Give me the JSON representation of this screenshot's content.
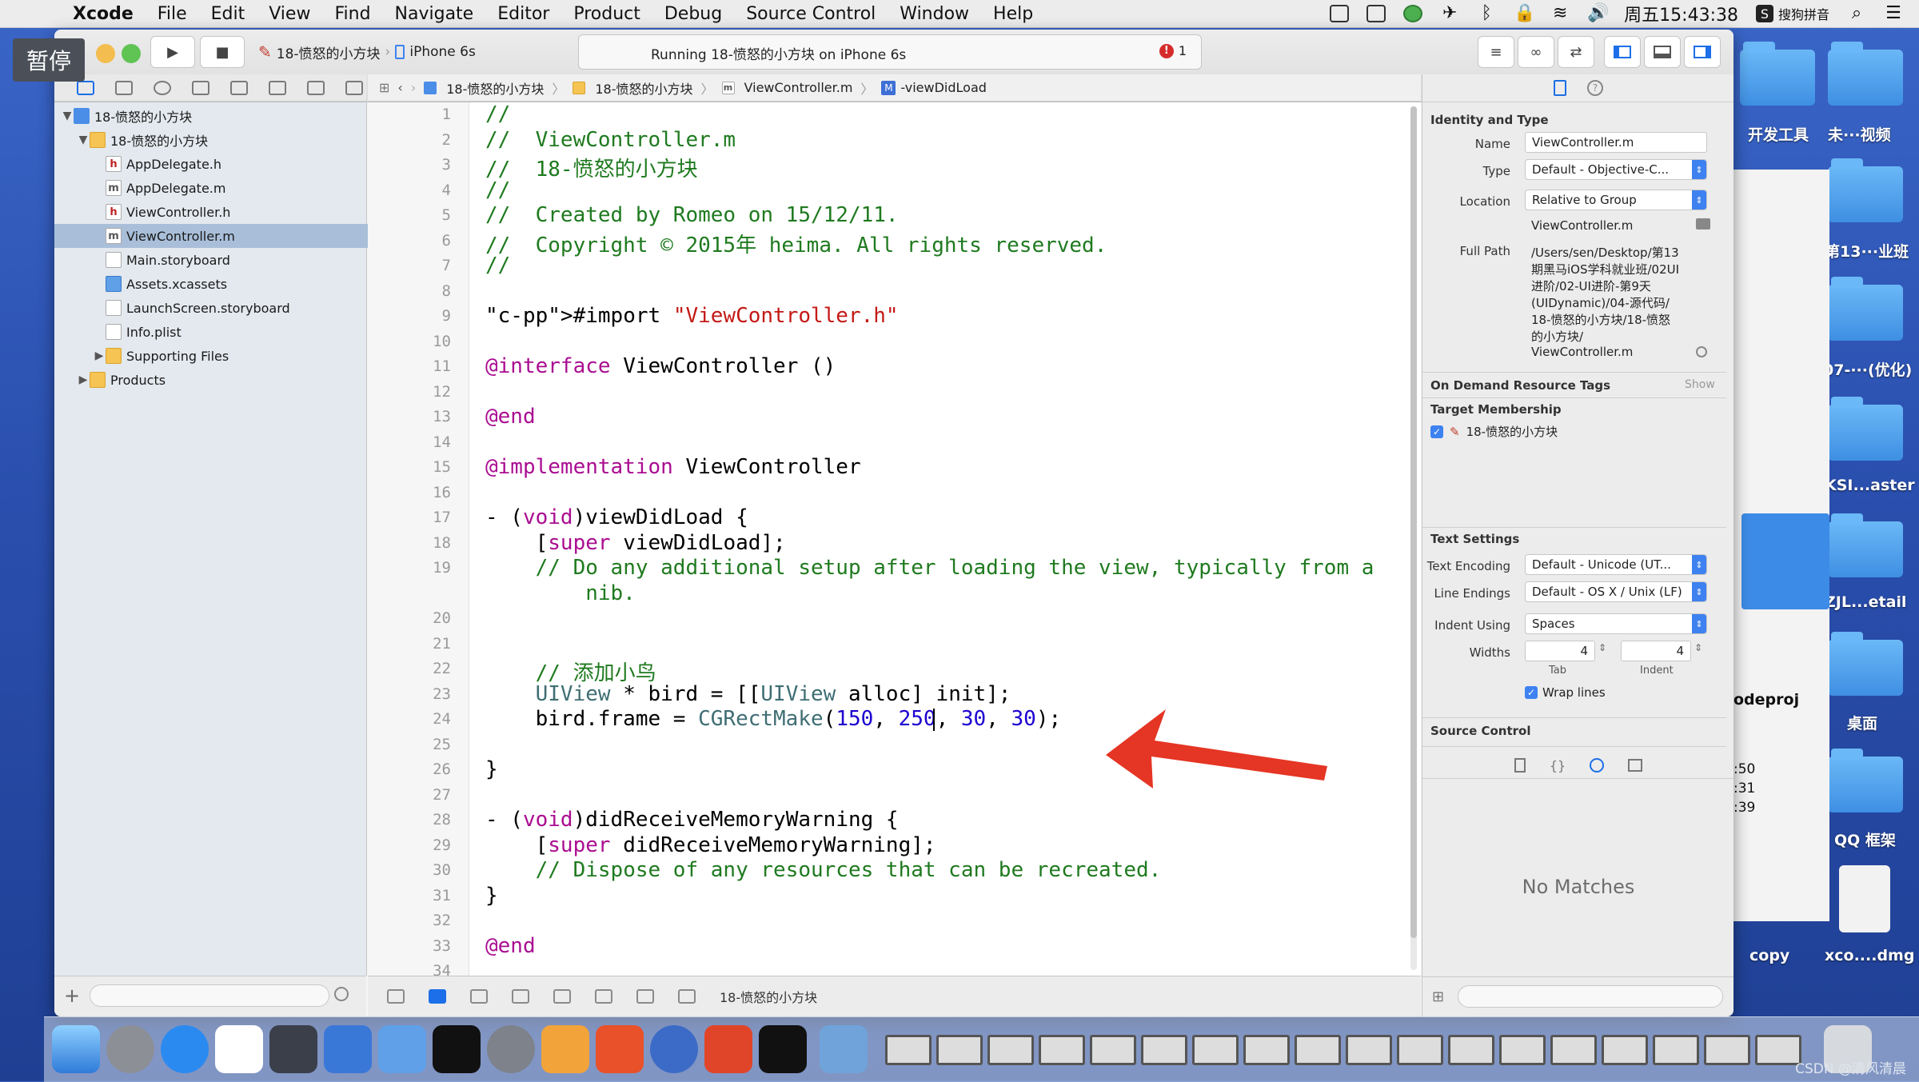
{
  "menubar": {
    "apple": "",
    "app": "Xcode",
    "items": [
      "File",
      "Edit",
      "View",
      "Find",
      "Navigate",
      "Editor",
      "Product",
      "Debug",
      "Source Control",
      "Window",
      "Help"
    ],
    "clock": "周五15:43:38",
    "input_method": "搜狗拼音"
  },
  "overlay": {
    "pause_label": "暂停"
  },
  "toolbar": {
    "scheme": "18-愤怒的小方块",
    "device": "iPhone 6s",
    "activity": "Running 18-愤怒的小方块 on iPhone 6s",
    "error_count": "1"
  },
  "navigator": {
    "rows": [
      {
        "name": "18-愤怒的小方块",
        "icon": "proj"
      },
      {
        "name": "18-愤怒的小方块",
        "icon": "folder"
      },
      {
        "name": "AppDelegate.h",
        "icon": "h"
      },
      {
        "name": "AppDelegate.m",
        "icon": "m"
      },
      {
        "name": "ViewController.h",
        "icon": "h"
      },
      {
        "name": "ViewController.m",
        "icon": "m"
      },
      {
        "name": "Main.storyboard",
        "icon": "sb"
      },
      {
        "name": "Assets.xcassets",
        "icon": "xc"
      },
      {
        "name": "LaunchScreen.storyboard",
        "icon": "sb"
      },
      {
        "name": "Info.plist",
        "icon": "pl"
      },
      {
        "name": "Supporting Files",
        "icon": "folder"
      },
      {
        "name": "Products",
        "icon": "folder"
      }
    ]
  },
  "jumpbar": {
    "crumbs": [
      "18-愤怒的小方块",
      "18-愤怒的小方块",
      "ViewController.m",
      "-viewDidLoad"
    ]
  },
  "editor": {
    "line_numbers": [
      "1",
      "2",
      "3",
      "4",
      "5",
      "6",
      "7",
      "8",
      "9",
      "10",
      "11",
      "12",
      "13",
      "14",
      "15",
      "16",
      "17",
      "18",
      "19",
      "",
      "20",
      "21",
      "22",
      "23",
      "24",
      "25",
      "26",
      "27",
      "28",
      "29",
      "30",
      "31",
      "32",
      "33",
      "34"
    ],
    "lines": [
      "//",
      "//  ViewController.m",
      "//  18-愤怒的小方块",
      "//",
      "//  Created by Romeo on 15/12/11.",
      "//  Copyright © 2015年 heima. All rights reserved.",
      "//",
      "",
      "#import \"ViewController.h\"",
      "",
      "@interface ViewController ()",
      "",
      "@end",
      "",
      "@implementation ViewController",
      "",
      "- (void)viewDidLoad {",
      "    [super viewDidLoad];",
      "    // Do any additional setup after loading the view, typically from a",
      "        nib.",
      "",
      "",
      "    // 添加小鸟",
      "    UIView * bird = [[UIView alloc] init];",
      "    bird.frame = CGRectMake(150, 250, 30, 30);",
      "",
      "}",
      "",
      "- (void)didReceiveMemoryWarning {",
      "    [super didReceiveMemoryWarning];",
      "    // Dispose of any resources that can be recreated.",
      "}",
      "",
      "@end",
      ""
    ],
    "status_scheme": "18-愤怒的小方块"
  },
  "inspector": {
    "identity_title": "Identity and Type",
    "name_label": "Name",
    "name_value": "ViewController.m",
    "type_label": "Type",
    "type_value": "Default - Objective-C...",
    "location_label": "Location",
    "location_value": "Relative to Group",
    "location_file": "ViewController.m",
    "fullpath_label": "Full Path",
    "fullpath_lines": [
      "/Users/sen/Desktop/第13",
      "期黑马iOS学科就业班/02UI",
      "进阶/02-UI进阶-第9天",
      "(UIDynamic)/04-源代码/",
      "18-愤怒的小方块/18-愤怒",
      "的小方块/",
      "ViewController.m"
    ],
    "odr_title": "On Demand Resource Tags",
    "odr_show": "Show",
    "target_title": "Target Membership",
    "target_name": "18-愤怒的小方块",
    "text_title": "Text Settings",
    "encoding_label": "Text Encoding",
    "encoding_value": "Default - Unicode (UT...",
    "endings_label": "Line Endings",
    "endings_value": "Default - OS X / Unix (LF)",
    "indent_label": "Indent Using",
    "indent_value": "Spaces",
    "widths_label": "Widths",
    "tab_value": "4",
    "indent_width_value": "4",
    "tab_label": "Tab",
    "indent_sub_label": "Indent",
    "wrap_label": "Wrap lines",
    "sc_title": "Source Control",
    "no_matches": "No Matches"
  },
  "desktop": {
    "labels": [
      "开发工具",
      "未···视频",
      "第13···业班",
      "07-···(优化)",
      "KSI...aster",
      "ZJL...etail",
      "桌面",
      "QQ 框架",
      "xco....dmg",
      "copy",
      "odeproj"
    ],
    "sidebar_nums": [
      ":50",
      ":31",
      ":39"
    ]
  },
  "watermark": "CSDN @清风清晨",
  "colors": {
    "selection": "#a9bfd9",
    "accent": "#3d82f0",
    "comment": "#1f7a1f",
    "keyword": "#aa0d91",
    "arrow": "#e53524"
  }
}
